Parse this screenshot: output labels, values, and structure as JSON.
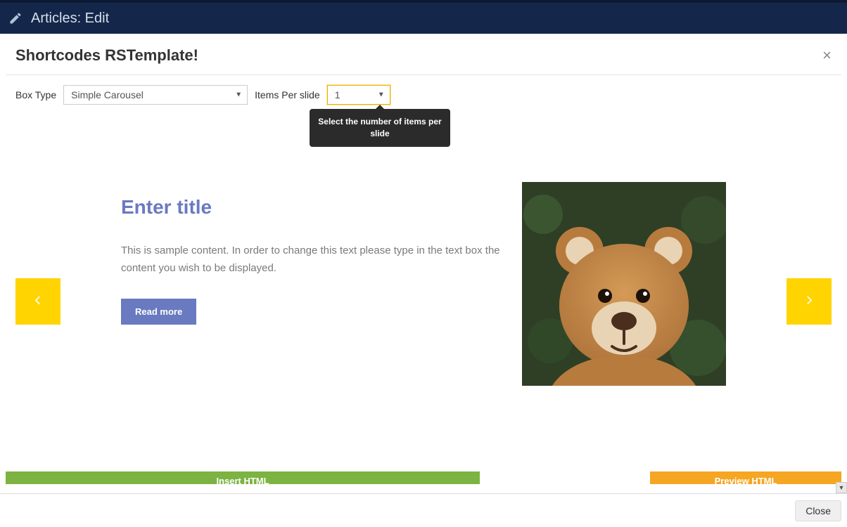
{
  "topbar": {
    "title": "Articles: Edit"
  },
  "modal": {
    "title": "Shortcodes RSTemplate!",
    "form": {
      "box_type_label": "Box Type",
      "box_type_value": "Simple Carousel",
      "items_per_slide_label": "Items Per slide",
      "items_per_slide_value": "1"
    },
    "tooltip": "Select the number of items per slide",
    "slide": {
      "title": "Enter title",
      "body": "This is sample content. In order to change this text please type in the text box the content you wish to be displayed.",
      "read_more_label": "Read more"
    },
    "actions": {
      "insert_html": "Insert HTML",
      "preview_html": "Preview HTML"
    }
  },
  "footer": {
    "close_label": "Close"
  }
}
